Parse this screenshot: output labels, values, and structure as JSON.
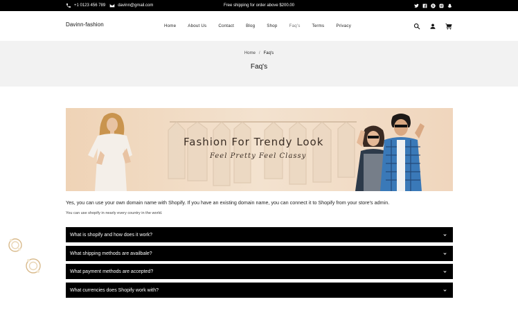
{
  "topbar": {
    "phone": "+1 0123 456 789",
    "email": "davinn@gmail.com",
    "promo": "Free shipping for order above $200.00",
    "social_icons": [
      "twitter-icon",
      "facebook-icon",
      "pinterest-icon",
      "instagram-icon",
      "snapchat-icon"
    ]
  },
  "header": {
    "logo": "Davinn-fashion",
    "nav": [
      "Home",
      "About Us",
      "Contact",
      "Blog",
      "Shop",
      "Faq's",
      "Terms",
      "Privacy"
    ],
    "active_nav": "Faq's",
    "icons": [
      "search-icon",
      "account-icon",
      "cart-icon"
    ]
  },
  "breadcrumb": {
    "home": "Home",
    "separator": "/",
    "current": "Faq's",
    "title": "Faq's"
  },
  "hero": {
    "title": "Fashion For Trendy Look",
    "subtitle": "Feel Pretty Feel Classy"
  },
  "answer": {
    "text": "Yes, you can use your own domain name with Shopify. If you have an existing domain name, you can connect it to Shopify from your store's admin.",
    "note": "You can use shopify in nearly every country in the world."
  },
  "faqs": [
    "What is shopify and how does it work?",
    "What shipping methods are availbale?",
    "What payment methods are accepted?",
    "What currencies does Shopify work with?"
  ],
  "colors": {
    "topbar": "#000000",
    "crumb_bg": "#f2f2f2",
    "accordion": "#000000",
    "hero_bg": "#f0d8c0"
  }
}
